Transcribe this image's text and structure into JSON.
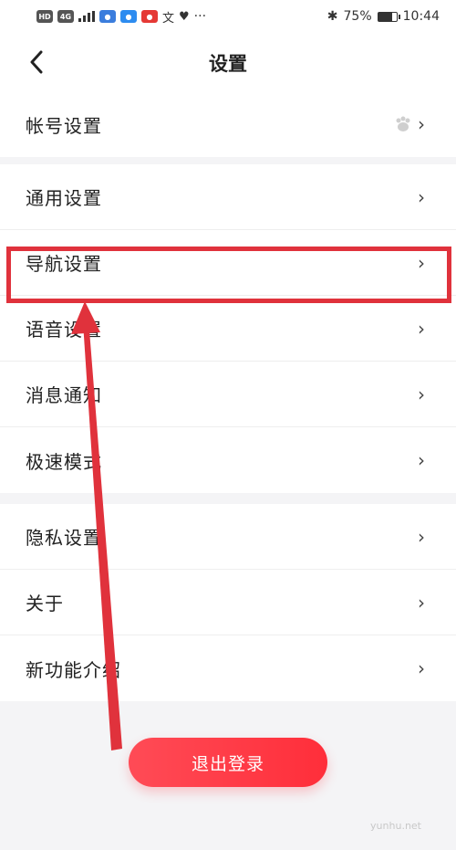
{
  "status_bar": {
    "left_badges": [
      {
        "text": "HD",
        "color": "#555555"
      },
      {
        "text": "4G",
        "color": "#555555"
      }
    ],
    "battery_percent": "75%",
    "battery_level": 0.75,
    "time": "10:44"
  },
  "header": {
    "title": "设置"
  },
  "groups": [
    {
      "items": [
        {
          "label": "帐号设置",
          "icon": "baidu-paw-icon"
        }
      ]
    },
    {
      "items": [
        {
          "label": "通用设置"
        },
        {
          "label": "导航设置"
        },
        {
          "label": "语音设置"
        },
        {
          "label": "消息通知"
        },
        {
          "label": "极速模式"
        }
      ]
    },
    {
      "items": [
        {
          "label": "隐私设置"
        },
        {
          "label": "关于"
        },
        {
          "label": "新功能介绍"
        }
      ]
    }
  ],
  "logout_label": "退出登录",
  "watermark": "yunhu.net",
  "colors": {
    "accent": "#ff2e3a",
    "highlight": "#e0323c"
  }
}
